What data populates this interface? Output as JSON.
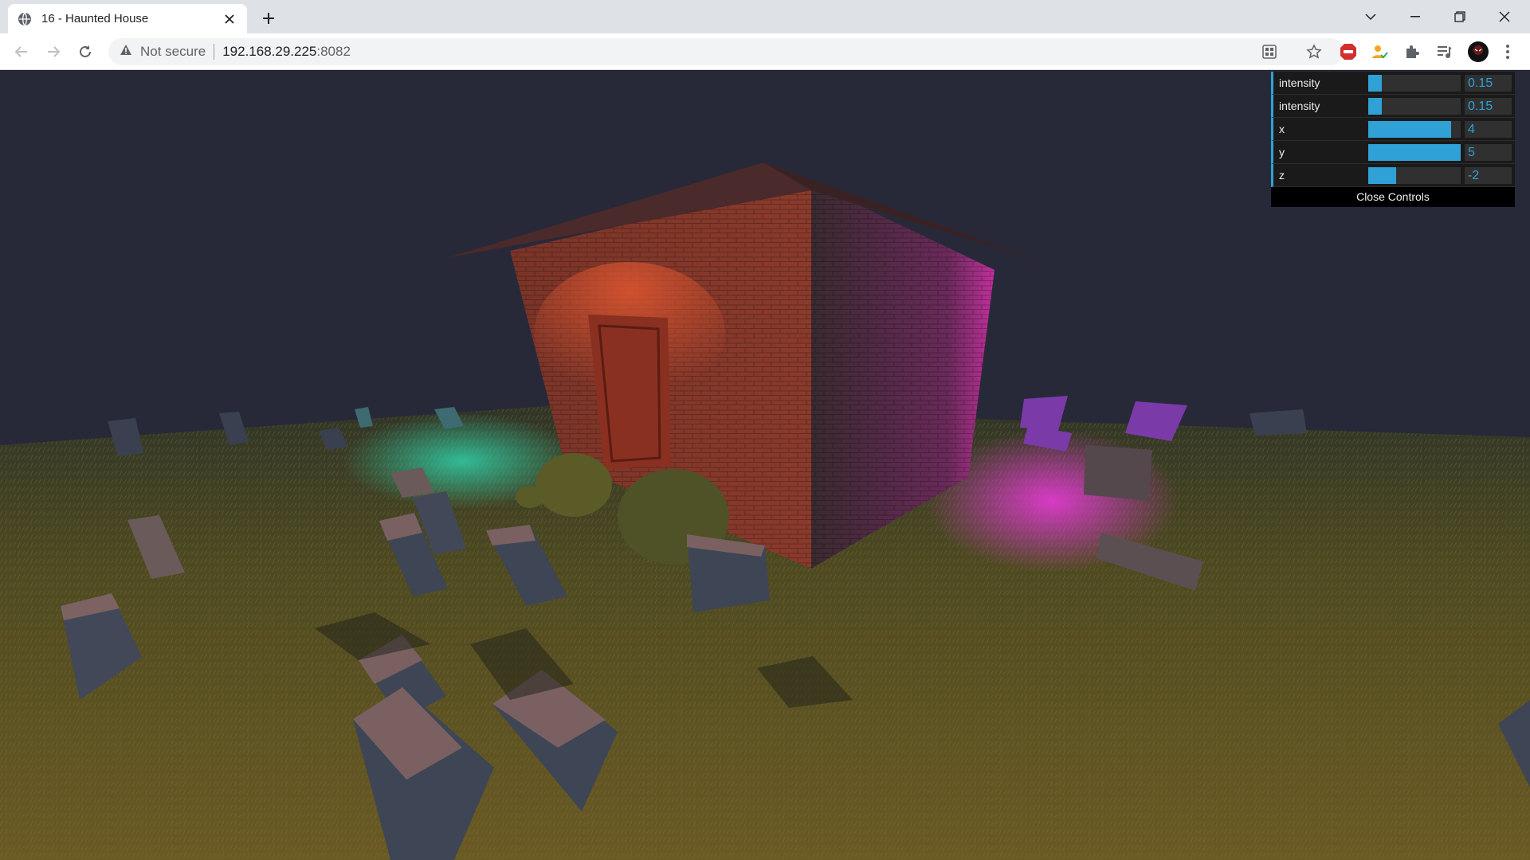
{
  "browser": {
    "tab_title": "16 - Haunted House",
    "security_label": "Not secure",
    "url_host": "192.168.29.225",
    "url_port": ":8082"
  },
  "gui": {
    "controls": [
      {
        "label": "intensity",
        "value": "0.15",
        "fill": 0.15
      },
      {
        "label": "intensity",
        "value": "0.15",
        "fill": 0.15
      },
      {
        "label": "x",
        "value": "4",
        "fill": 0.9
      },
      {
        "label": "y",
        "value": "5",
        "fill": 1.0
      },
      {
        "label": "z",
        "value": "-2",
        "fill": 0.3
      }
    ],
    "close_label": "Close Controls"
  },
  "colors": {
    "accent": "#2fa1d6",
    "fog": "#262837",
    "brick": "#8a3a2a",
    "grass": "#5f5222"
  }
}
